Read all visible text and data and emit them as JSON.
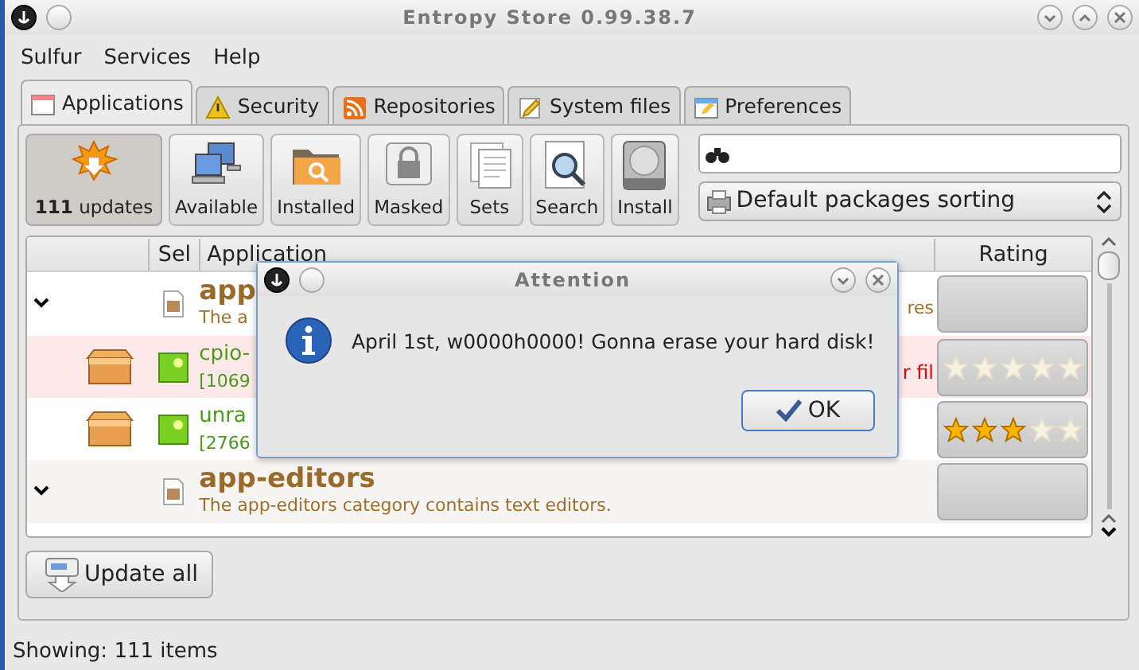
{
  "window": {
    "title": "Entropy Store 0.99.38.7"
  },
  "menu": [
    "Sulfur",
    "Services",
    "Help"
  ],
  "tabs": [
    {
      "label": "Applications",
      "selected": true
    },
    {
      "label": "Security",
      "selected": false
    },
    {
      "label": "Repositories",
      "selected": false
    },
    {
      "label": "System files",
      "selected": false
    },
    {
      "label": "Preferences",
      "selected": false
    }
  ],
  "toolbar": [
    {
      "label": "**111** updates",
      "selected": true
    },
    {
      "label": "Available",
      "selected": false
    },
    {
      "label": "Installed",
      "selected": false
    },
    {
      "label": "Masked",
      "selected": false
    },
    {
      "label": "Sets",
      "selected": false
    },
    {
      "label": "Search",
      "selected": false
    },
    {
      "label": "Install",
      "selected": false
    }
  ],
  "sort": {
    "value": "Default packages sorting"
  },
  "table": {
    "columns": [
      "Sel",
      "Application",
      "Rating"
    ],
    "rows": [
      {
        "kind": "category",
        "expanded": true,
        "name": "app",
        "description": "The a",
        "tail": "res"
      },
      {
        "kind": "package",
        "checked": true,
        "highlighted": true,
        "name": "cpio-",
        "details": "[1069",
        "tail": "r fil",
        "stars": 0
      },
      {
        "kind": "package",
        "checked": true,
        "highlighted": false,
        "name": "unra",
        "details": "[2766",
        "stars": 3
      },
      {
        "kind": "category",
        "expanded": true,
        "name": "app-editors",
        "description": "The app-editors category contains text editors."
      }
    ]
  },
  "update_button": "Update all",
  "status_bar": "Showing: 111 items",
  "dialog": {
    "title": "Attention",
    "message": "April 1st, w0000h0000! Gonna erase your hard disk!",
    "button": "OK"
  }
}
